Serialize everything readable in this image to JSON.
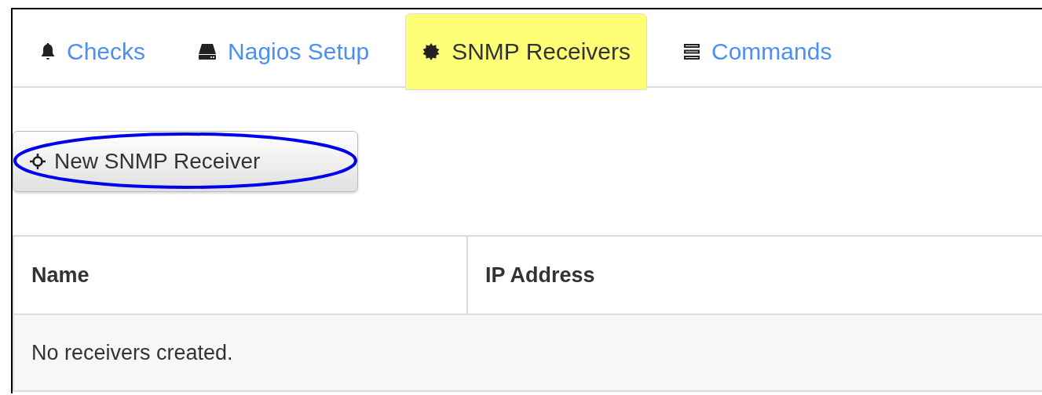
{
  "tabs": [
    {
      "label": "Checks",
      "selected": false
    },
    {
      "label": "Nagios Setup",
      "selected": false
    },
    {
      "label": "SNMP Receivers",
      "selected": true
    },
    {
      "label": "Commands",
      "selected": false
    }
  ],
  "new_button": {
    "label": "New SNMP Receiver",
    "circled": true
  },
  "table": {
    "columns": [
      "Name",
      "IP Address"
    ],
    "empty_message": "No receivers created."
  }
}
